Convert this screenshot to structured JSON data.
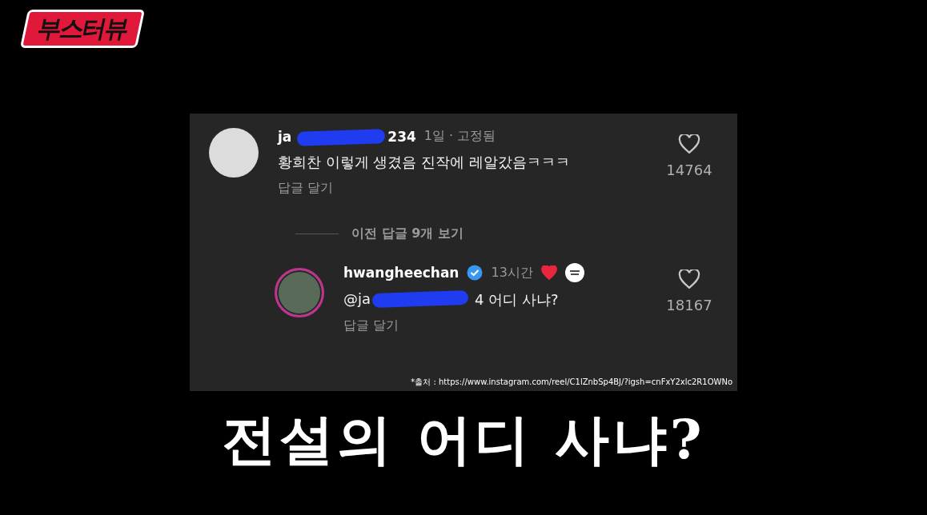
{
  "logo": {
    "text": "부스터뷰"
  },
  "comments": [
    {
      "kind": "comment",
      "username_start": "ja",
      "username_end": "234",
      "verified": false,
      "time": "1일 · 고정됨",
      "creator_liked": false,
      "text": "황희찬 이렇게 생겼음 진작에 레알갔음ㅋㅋㅋ",
      "reply_label": "답글 달기",
      "likes": "14764"
    },
    {
      "kind": "divider",
      "label": "이전 답글 9개 보기"
    },
    {
      "kind": "reply",
      "username_start": "hwangheechan",
      "verified": true,
      "time": "13시간",
      "creator_liked": true,
      "text_start": "@ja",
      "text": "4 어디 사냐?",
      "reply_label": "답글 달기",
      "likes": "18167"
    }
  ],
  "source": "*출처 : https://www.instagram.com/reel/C1lZnbSp4BJ/?igsh=cnFxY2xlc2R1OWNo",
  "caption": "전설의 어디 사냐?"
}
